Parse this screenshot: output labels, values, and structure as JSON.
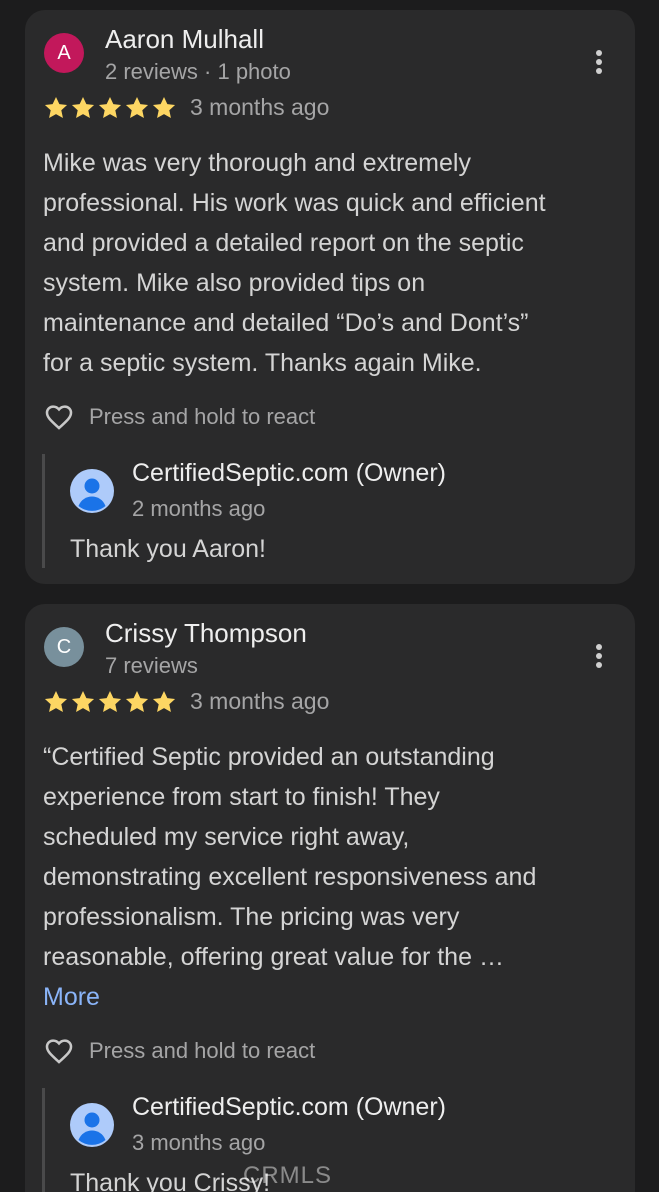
{
  "reviews": [
    {
      "initial": "A",
      "avatar_color": "#c2185b",
      "name": "Aaron Mulhall",
      "meta": "2 reviews · 1 photo",
      "stars": 5,
      "time": "3 months ago",
      "text_lines": [
        "Mike was very thorough and extremely",
        "professional. His work was quick and efficient",
        "and provided a detailed report on the septic",
        "system. Mike also provided tips on",
        "maintenance and detailed “Do’s and Dont’s”",
        "for a septic system. Thanks again Mike."
      ],
      "react_label": "Press and hold to react",
      "reply": {
        "owner": "CertifiedSeptic.com (Owner)",
        "time": "2 months ago",
        "text": "Thank you Aaron!"
      }
    },
    {
      "initial": "C",
      "avatar_color": "#78909c",
      "name": "Crissy Thompson",
      "meta": "7 reviews",
      "stars": 5,
      "time": "3 months ago",
      "text_lines": [
        "“Certified Septic provided an outstanding",
        "experience from start to finish! They",
        "scheduled my service right away,",
        "demonstrating excellent responsiveness and",
        "professionalism. The pricing was very",
        "reasonable, offering great value for the …"
      ],
      "more_label": "More",
      "react_label": "Press and hold to react",
      "reply": {
        "owner": "CertifiedSeptic.com (Owner)",
        "time": "3 months ago",
        "text": "Thank you Crissy!"
      }
    }
  ],
  "colors": {
    "star": "#fdd663",
    "link": "#8ab4f8",
    "card": "#2a2a2b",
    "background": "#1c1c1d"
  },
  "icons": {
    "options": "more-vert-icon",
    "react": "heart-outline-icon",
    "star": "star-icon",
    "owner_avatar": "person-avatar-icon"
  },
  "watermark": "CRMLS"
}
